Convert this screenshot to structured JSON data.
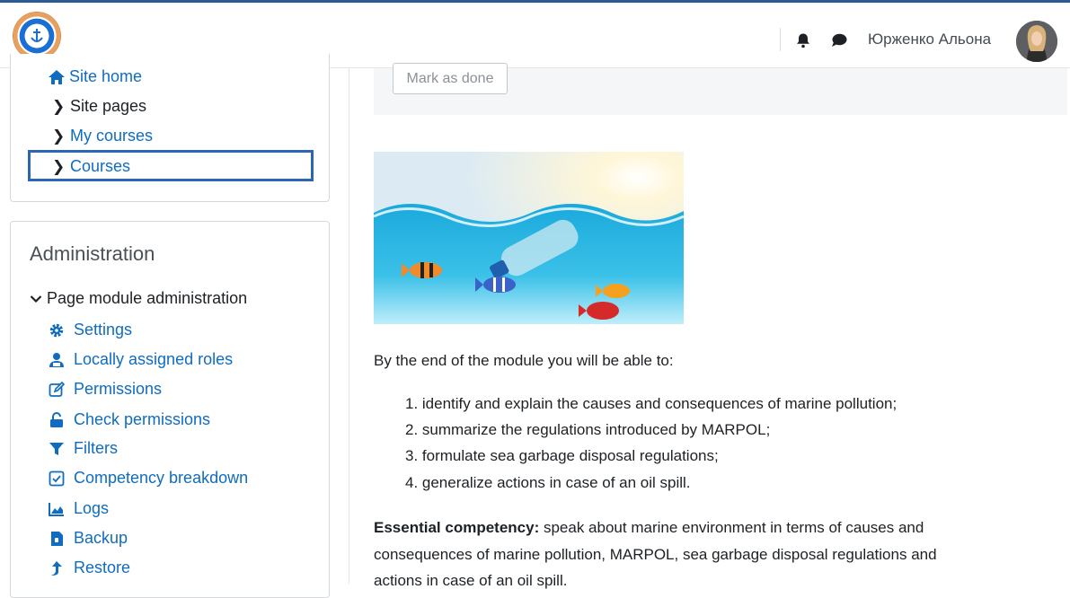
{
  "navbar": {
    "user_name": "Юрженко Альона"
  },
  "sidebar": {
    "nav_items": [
      {
        "label": "Site home"
      },
      {
        "label": "Site pages"
      },
      {
        "label": "My courses"
      },
      {
        "label": "Courses"
      }
    ],
    "admin": {
      "title": "Administration",
      "section": "Page module administration",
      "items": [
        {
          "label": "Settings",
          "icon": "gear-icon"
        },
        {
          "label": "Locally assigned roles",
          "icon": "user-roles-icon"
        },
        {
          "label": "Permissions",
          "icon": "pencil-square-icon"
        },
        {
          "label": "Check permissions",
          "icon": "unlock-icon"
        },
        {
          "label": "Filters",
          "icon": "filter-icon"
        },
        {
          "label": "Competency breakdown",
          "icon": "checkbox-icon"
        },
        {
          "label": "Logs",
          "icon": "area-chart-icon"
        },
        {
          "label": "Backup",
          "icon": "file-archive-icon"
        },
        {
          "label": "Restore",
          "icon": "upload-arrow-icon"
        }
      ]
    }
  },
  "main": {
    "mark_as_done": "Mark as done",
    "intro": "By the end of the module you will be able to:",
    "objectives": [
      "1. identify and explain the causes and consequences of marine pollution;",
      "2. summarize the regulations introduced by MARPOL;",
      "3. formulate sea garbage disposal regulations;",
      "4. generalize actions in case of an oil spill."
    ],
    "essential_label": "Essential competency:",
    "essential_line1": " speak about marine environment in terms of causes and",
    "essential_line2": "consequences of marine pollution, MARPOL, sea garbage disposal regulations and",
    "essential_line3": "actions in case of an oil spill."
  },
  "colors": {
    "link": "#0f6cbf",
    "focus_border": "#2a66b2",
    "top_bar": "#2b5b96"
  }
}
